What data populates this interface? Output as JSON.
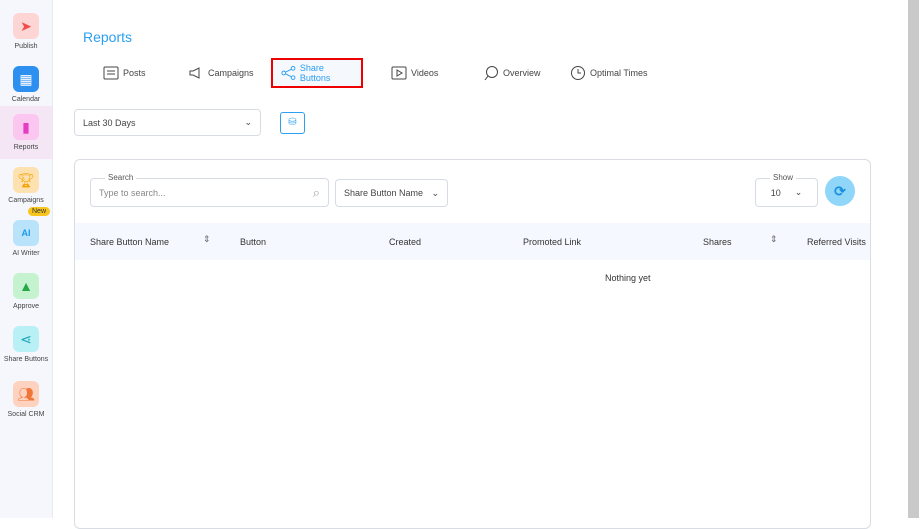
{
  "sidebar": {
    "items": [
      {
        "label": "Publish",
        "icon": "paper-plane-icon",
        "color": "#fdd5d5",
        "glyph": "#f24d4d"
      },
      {
        "label": "Calendar",
        "icon": "calendar-icon",
        "color": "#2d8ff0",
        "glyph": "#fff"
      },
      {
        "label": "Reports",
        "icon": "bar-chart-icon",
        "color": "#fbc6ef",
        "glyph": "#e33dc4"
      },
      {
        "label": "Campaigns",
        "icon": "trophy-icon",
        "color": "#fde1b0",
        "glyph": "#f5a100"
      },
      {
        "label": "AI Writer",
        "icon": "ai-pen-icon",
        "color": "#b9e3fb",
        "glyph": "#1a9ae6",
        "badge": "New"
      },
      {
        "label": "Approve",
        "icon": "image-check-icon",
        "color": "#c6f3cf",
        "glyph": "#26a84a"
      },
      {
        "label": "Share Buttons",
        "icon": "share-icon",
        "color": "#b8f0f5",
        "glyph": "#17a3b5"
      },
      {
        "label": "Social CRM",
        "icon": "users-icon",
        "color": "#fdd2bf",
        "glyph": "#f07538"
      }
    ]
  },
  "header": {
    "title": "Reports"
  },
  "tabs": [
    {
      "label": "Posts"
    },
    {
      "label": "Campaigns"
    },
    {
      "label": "Share Buttons"
    },
    {
      "label": "Videos"
    },
    {
      "label": "Overview"
    },
    {
      "label": "Optimal Times"
    }
  ],
  "filters": {
    "date_range": "Last 30 Days"
  },
  "table": {
    "search_legend": "Search",
    "search_placeholder": "Type to search...",
    "sort_by": "Share Button Name",
    "show_legend": "Show",
    "show_value": "10",
    "columns": [
      "Share Button Name",
      "Button",
      "Created",
      "Promoted Link",
      "Shares",
      "Referred Visits"
    ],
    "empty": "Nothing yet"
  }
}
